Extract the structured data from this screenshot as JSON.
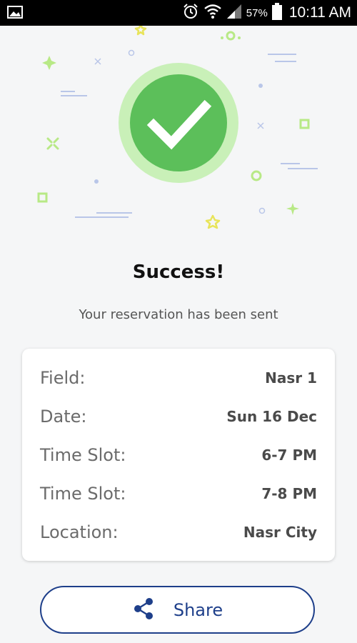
{
  "status_bar": {
    "battery": "57%",
    "time": "10:11 AM"
  },
  "success": {
    "title": "Success!",
    "message": "Your reservation has been sent"
  },
  "reservation": {
    "rows": [
      {
        "label": "Field:",
        "value": "Nasr 1"
      },
      {
        "label": "Date:",
        "value": "Sun 16 Dec"
      },
      {
        "label": "Time Slot:",
        "value": "6-7 PM"
      },
      {
        "label": "Time Slot:",
        "value": "7-8 PM"
      },
      {
        "label": "Location:",
        "value": "Nasr City"
      }
    ]
  },
  "share_button": {
    "label": "Share",
    "icon": "share-icon"
  },
  "colors": {
    "accent": "#1e3f8a",
    "success": "#5cbf5a",
    "success_ring": "#c9f0b8"
  }
}
